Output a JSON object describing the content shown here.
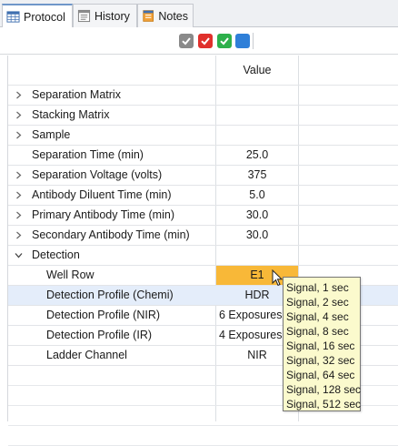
{
  "tabs": [
    {
      "label": "Protocol",
      "icon": "grid-icon",
      "active": true
    },
    {
      "label": "History",
      "icon": "history-icon",
      "active": false
    },
    {
      "label": "Notes",
      "icon": "notes-icon",
      "active": false
    }
  ],
  "toolbar": {
    "buttons": [
      {
        "name": "check-gray-button",
        "color": "#8a8a8a"
      },
      {
        "name": "check-red-button",
        "color": "#e0302c"
      },
      {
        "name": "check-green-button",
        "color": "#2db04b"
      },
      {
        "name": "blue-square-button",
        "color": "#2f7fd8"
      }
    ]
  },
  "grid": {
    "value_header": "Value",
    "rows": [
      {
        "label": "Separation Matrix",
        "value": "",
        "expander": "collapsed"
      },
      {
        "label": "Stacking Matrix",
        "value": "",
        "expander": "collapsed"
      },
      {
        "label": "Sample",
        "value": "",
        "expander": "collapsed"
      },
      {
        "label": "Separation Time (min)",
        "value": "25.0",
        "expander": "none"
      },
      {
        "label": "Separation Voltage (volts)",
        "value": "375",
        "expander": "collapsed"
      },
      {
        "label": "Antibody Diluent Time (min)",
        "value": "5.0",
        "expander": "collapsed"
      },
      {
        "label": "Primary Antibody Time (min)",
        "value": "30.0",
        "expander": "collapsed"
      },
      {
        "label": "Secondary Antibody Time (min)",
        "value": "30.0",
        "expander": "collapsed"
      },
      {
        "label": "Detection",
        "value": "",
        "expander": "expanded"
      },
      {
        "label": "Well Row",
        "value": "E1",
        "child": true
      },
      {
        "label": "Detection Profile (Chemi)",
        "value": "HDR",
        "child": true
      },
      {
        "label": "Detection Profile (NIR)",
        "value": "6 Exposures",
        "child": true
      },
      {
        "label": "Detection Profile (IR)",
        "value": "4 Exposures",
        "child": true
      },
      {
        "label": "Ladder Channel",
        "value": "NIR",
        "child": true
      }
    ],
    "highlight_color": "#f8b838",
    "selection_color": "#e4edfa"
  },
  "tooltip": {
    "items": [
      "Signal, 1 sec",
      "Signal, 2 sec",
      "Signal, 4 sec",
      "Signal, 8 sec",
      "Signal, 16 sec",
      "Signal, 32 sec",
      "Signal, 64 sec",
      "Signal, 128 sec",
      "Signal, 512 sec"
    ],
    "background": "#fbfacd"
  }
}
